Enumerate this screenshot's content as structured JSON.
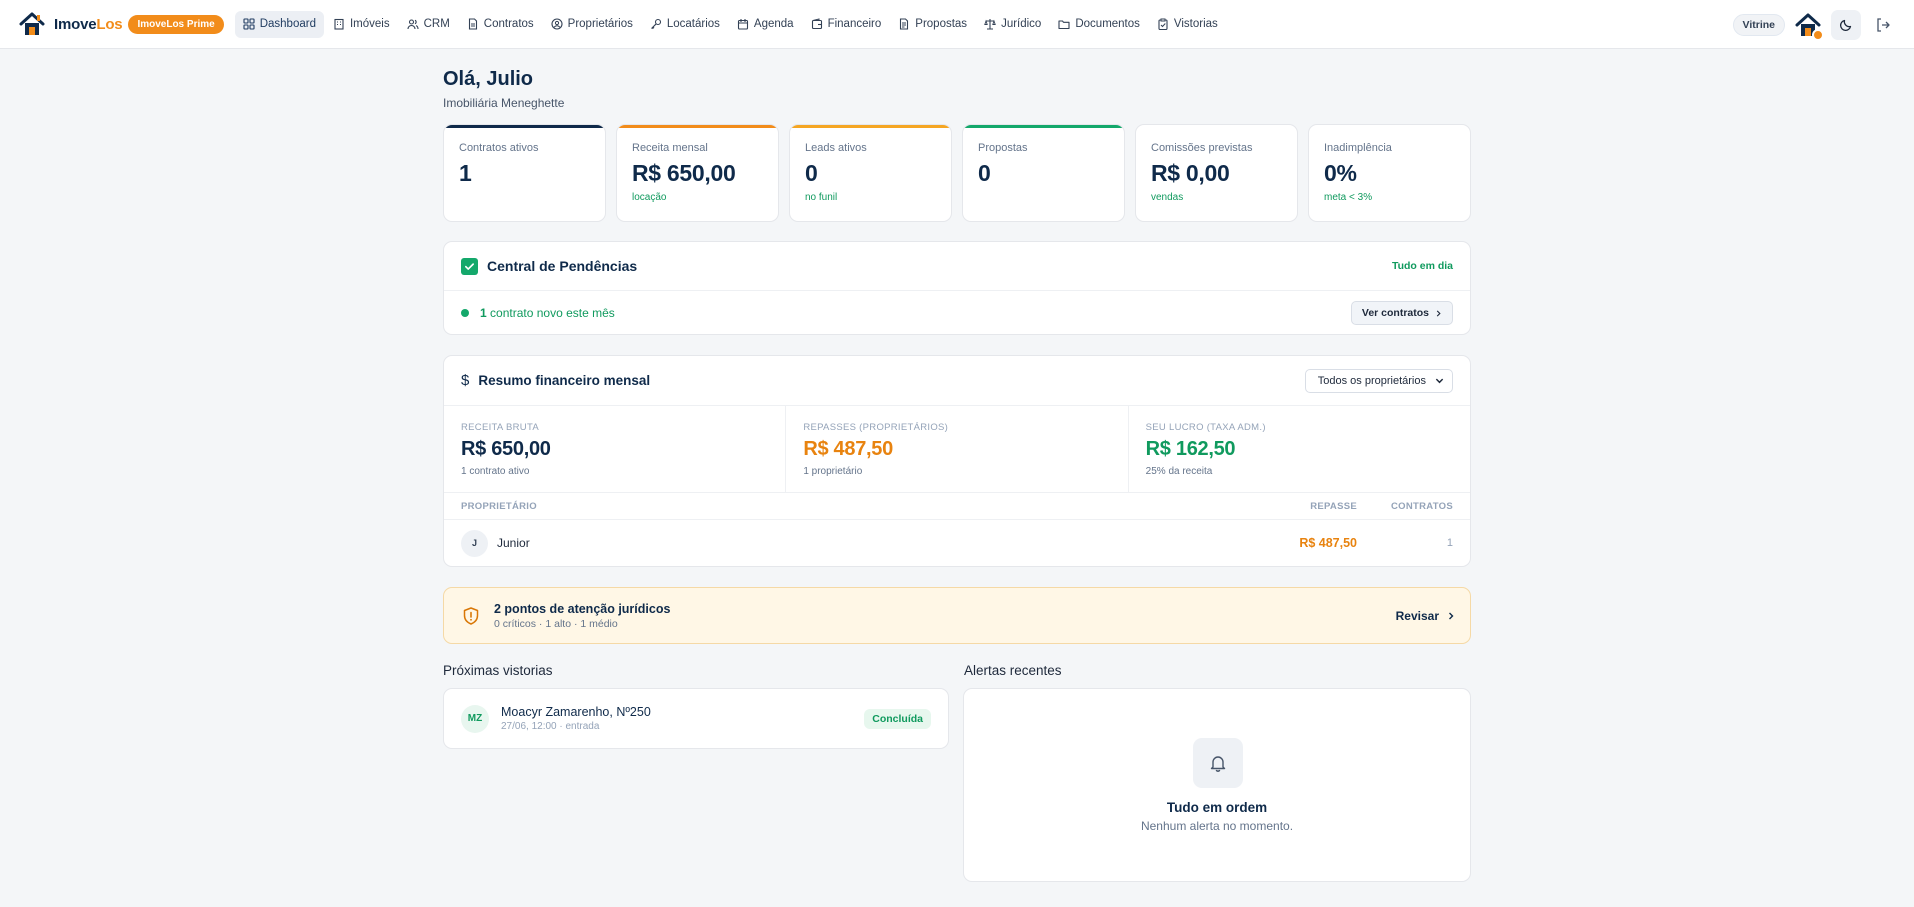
{
  "brand": {
    "name_part1": "Imove",
    "name_part2": "Los",
    "badge": "ImoveLos Prime"
  },
  "nav": {
    "items": [
      {
        "label": "Dashboard",
        "icon": "dashboard-icon",
        "active": true
      },
      {
        "label": "Imóveis",
        "icon": "building-icon"
      },
      {
        "label": "CRM",
        "icon": "users-icon"
      },
      {
        "label": "Contratos",
        "icon": "file-icon"
      },
      {
        "label": "Proprietários",
        "icon": "owner-icon"
      },
      {
        "label": "Locatários",
        "icon": "key-icon"
      },
      {
        "label": "Agenda",
        "icon": "calendar-icon"
      },
      {
        "label": "Financeiro",
        "icon": "wallet-icon"
      },
      {
        "label": "Propostas",
        "icon": "document-icon"
      },
      {
        "label": "Jurídico",
        "icon": "scale-icon"
      },
      {
        "label": "Documentos",
        "icon": "folder-icon"
      },
      {
        "label": "Vistorias",
        "icon": "clipboard-icon"
      }
    ],
    "vitrine_label": "Vitrine"
  },
  "greeting": {
    "title": "Olá, Julio",
    "subtitle": "Imobiliária Meneghette"
  },
  "stats": [
    {
      "label": "Contratos ativos",
      "value": "1",
      "sub": ""
    },
    {
      "label": "Receita mensal",
      "value": "R$ 650,00",
      "sub": "locação"
    },
    {
      "label": "Leads ativos",
      "value": "0",
      "sub": "no funil"
    },
    {
      "label": "Propostas",
      "value": "0",
      "sub": ""
    },
    {
      "label": "Comissões previstas",
      "value": "R$ 0,00",
      "sub": "vendas"
    },
    {
      "label": "Inadimplência",
      "value": "0%",
      "sub": "meta < 3%"
    }
  ],
  "pendencias": {
    "title": "Central de Pendências",
    "status": "Tudo em dia",
    "item_count": "1",
    "item_text": " contrato novo este mês",
    "button": "Ver contratos"
  },
  "financeiro": {
    "title": "Resumo financeiro mensal",
    "filter_value": "Todos os proprietários",
    "cols": [
      {
        "label": "RECEITA BRUTA",
        "value": "R$ 650,00",
        "sub": "1 contrato ativo"
      },
      {
        "label": "REPASSES (PROPRIETÁRIOS)",
        "value": "R$ 487,50",
        "sub": "1 proprietário"
      },
      {
        "label": "SEU LUCRO (TAXA ADM.)",
        "value": "R$ 162,50",
        "sub": "25% da receita"
      }
    ],
    "table_headers": {
      "owner": "PROPRIETÁRIO",
      "repasse": "REPASSE",
      "contratos": "CONTRATOS"
    },
    "rows": [
      {
        "initial": "J",
        "name": "Junior",
        "repasse": "R$ 487,50",
        "contratos": "1"
      }
    ]
  },
  "juridico": {
    "title": "2 pontos de atenção jurídicos",
    "sub": "0 críticos · 1 alto · 1 médio",
    "button": "Revisar"
  },
  "vistorias": {
    "title": "Próximas vistorias",
    "items": [
      {
        "initials": "MZ",
        "address": "Moacyr Zamarenho, Nº250",
        "meta": "27/06, 12:00 · entrada",
        "status": "Concluída"
      }
    ]
  },
  "alertas": {
    "title": "Alertas recentes",
    "empty_title": "Tudo em ordem",
    "empty_sub": "Nenhum alerta no momento."
  },
  "colors": {
    "navy": "#0f2a4a",
    "orange": "#f28c1a",
    "green": "#14a86b",
    "amber": "#f5a623"
  }
}
